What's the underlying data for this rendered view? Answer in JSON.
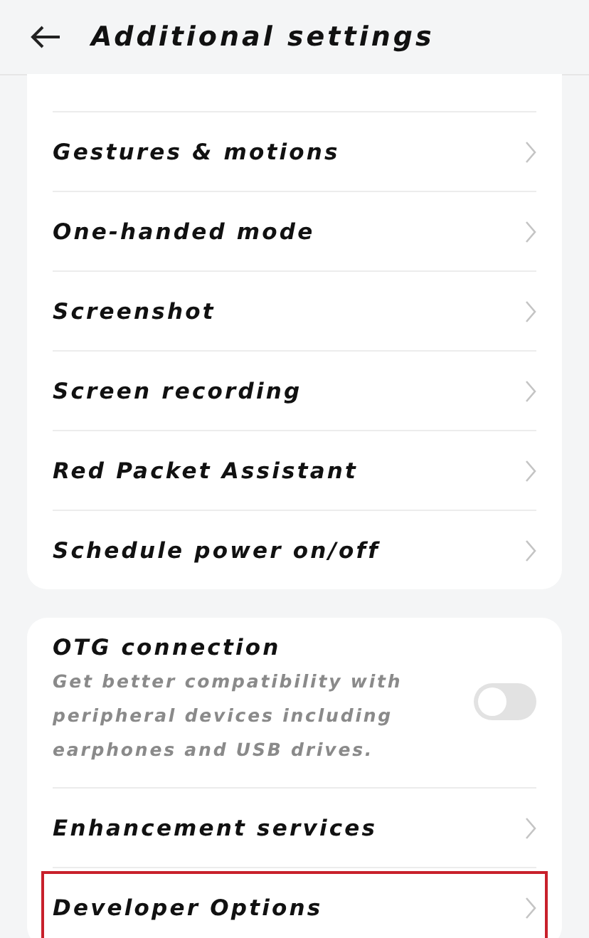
{
  "header": {
    "title": "Additional settings"
  },
  "groups": [
    {
      "items": [
        {
          "kind": "link",
          "label": "Gestures & motions",
          "highlighted": false
        },
        {
          "kind": "link",
          "label": "One-handed mode",
          "highlighted": false
        },
        {
          "kind": "link",
          "label": "Screenshot",
          "highlighted": false
        },
        {
          "kind": "link",
          "label": "Screen recording",
          "highlighted": false
        },
        {
          "kind": "link",
          "label": "Red Packet Assistant",
          "highlighted": false
        },
        {
          "kind": "link",
          "label": "Schedule power on/off",
          "highlighted": false
        }
      ]
    },
    {
      "items": [
        {
          "kind": "toggle",
          "label": "OTG connection",
          "description": "Get better compatibility with peripheral devices including earphones and USB drives.",
          "on": false,
          "highlighted": false
        },
        {
          "kind": "link",
          "label": "Enhancement services",
          "highlighted": false
        },
        {
          "kind": "link",
          "label": "Developer Options",
          "highlighted": true
        }
      ]
    }
  ]
}
